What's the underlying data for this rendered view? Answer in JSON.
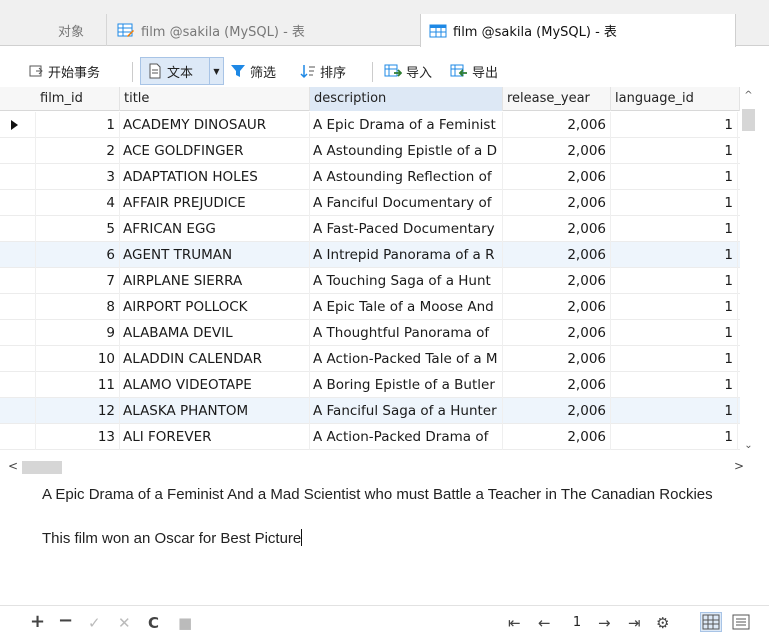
{
  "tabs": [
    {
      "label": "对象"
    },
    {
      "label": "film @sakila (MySQL) - 表"
    },
    {
      "label": "film @sakila (MySQL) - 表"
    }
  ],
  "toolbar": {
    "begin_transaction": "开始事务",
    "text_view": "文本",
    "filter": "筛选",
    "sort": "排序",
    "import": "导入",
    "export": "导出"
  },
  "grid": {
    "columns": [
      "film_id",
      "title",
      "description",
      "release_year",
      "language_id"
    ],
    "rows": [
      {
        "film_id": "1",
        "title": "ACADEMY DINOSAUR",
        "description": "A Epic Drama of a Feminist",
        "release_year": "2,006",
        "language_id": "1"
      },
      {
        "film_id": "2",
        "title": "ACE GOLDFINGER",
        "description": "A Astounding Epistle of a D",
        "release_year": "2,006",
        "language_id": "1"
      },
      {
        "film_id": "3",
        "title": "ADAPTATION HOLES",
        "description": "A Astounding Reflection of",
        "release_year": "2,006",
        "language_id": "1"
      },
      {
        "film_id": "4",
        "title": "AFFAIR PREJUDICE",
        "description": "A Fanciful Documentary of",
        "release_year": "2,006",
        "language_id": "1"
      },
      {
        "film_id": "5",
        "title": "AFRICAN EGG",
        "description": "A Fast-Paced Documentary",
        "release_year": "2,006",
        "language_id": "1"
      },
      {
        "film_id": "6",
        "title": "AGENT TRUMAN",
        "description": "A Intrepid Panorama of a R",
        "release_year": "2,006",
        "language_id": "1"
      },
      {
        "film_id": "7",
        "title": "AIRPLANE SIERRA",
        "description": "A Touching Saga of a Hunt",
        "release_year": "2,006",
        "language_id": "1"
      },
      {
        "film_id": "8",
        "title": "AIRPORT POLLOCK",
        "description": "A Epic Tale of a Moose And",
        "release_year": "2,006",
        "language_id": "1"
      },
      {
        "film_id": "9",
        "title": "ALABAMA DEVIL",
        "description": "A Thoughtful Panorama of",
        "release_year": "2,006",
        "language_id": "1"
      },
      {
        "film_id": "10",
        "title": "ALADDIN CALENDAR",
        "description": "A Action-Packed Tale of a M",
        "release_year": "2,006",
        "language_id": "1"
      },
      {
        "film_id": "11",
        "title": "ALAMO VIDEOTAPE",
        "description": "A Boring Epistle of a Butler",
        "release_year": "2,006",
        "language_id": "1"
      },
      {
        "film_id": "12",
        "title": "ALASKA PHANTOM",
        "description": "A Fanciful Saga of a Hunter",
        "release_year": "2,006",
        "language_id": "1"
      },
      {
        "film_id": "13",
        "title": "ALI FOREVER",
        "description": "A Action-Packed Drama of",
        "release_year": "2,006",
        "language_id": "1"
      }
    ]
  },
  "preview": {
    "line1": "A Epic Drama of a Feminist And a Mad Scientist who must Battle a Teacher in The Canadian Rockies",
    "line2": "This film won an Oscar for Best Picture"
  },
  "pager": {
    "page": "1"
  },
  "colors": {
    "accent": "#dde9f7",
    "accent_border": "#a8c4e6",
    "import_icon": "#2e7d32",
    "export_icon": "#2e7d32",
    "tab_icon": "#1e88e5"
  }
}
